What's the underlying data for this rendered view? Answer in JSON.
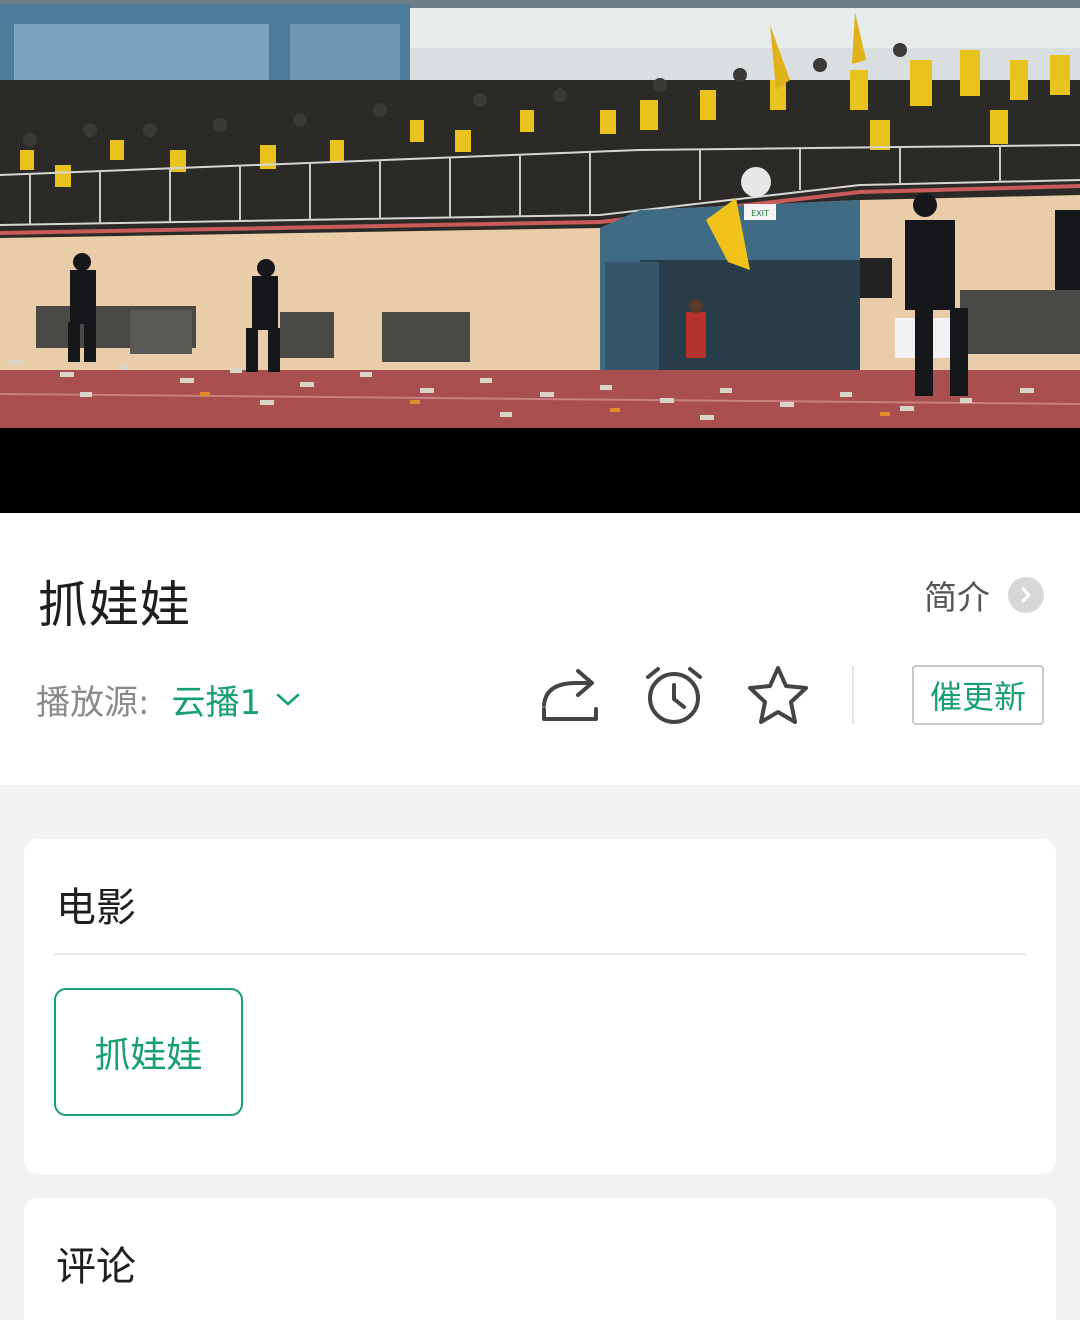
{
  "video": {
    "exit_sign": "EXIT"
  },
  "info": {
    "title": "抓娃娃",
    "intro_label": "简介",
    "source_label": "播放源:",
    "source_value": "云播1",
    "urge_label": "催更新",
    "icons": {
      "intro": "chevron-right-icon",
      "source": "chevron-down-icon",
      "share": "share-icon",
      "alarm": "alarm-clock-icon",
      "favorite": "star-icon"
    }
  },
  "sections": {
    "movie": {
      "title": "电影",
      "episodes": [
        "抓娃娃"
      ]
    },
    "comments": {
      "title": "评论"
    }
  },
  "colors": {
    "accent": "#17a06f",
    "track": "#a94f4f",
    "stand_wall": "#e9cda9",
    "fan_yellow": "#e8c21d"
  }
}
